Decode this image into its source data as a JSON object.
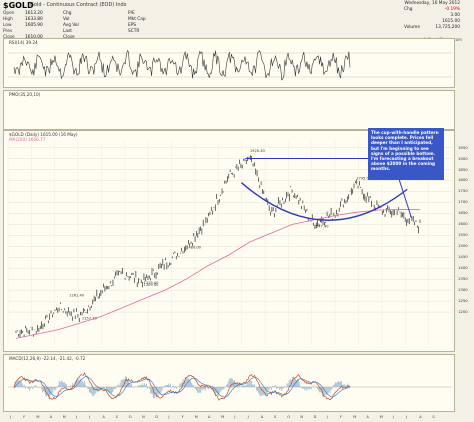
{
  "header": {
    "ticker": "$GOLD",
    "description": "Gold - Continuous Contract (EOD) Indx",
    "stats_left": [
      {
        "label": "Open",
        "value": "1613.20"
      },
      {
        "label": "High",
        "value": "1633.80"
      },
      {
        "label": "Low",
        "value": "1605.90"
      },
      {
        "label": "Prev Close",
        "value": "1610.00"
      }
    ],
    "stats_mid": [
      {
        "label": "Chg",
        "value": ""
      },
      {
        "label": "Vol",
        "value": ""
      },
      {
        "label": "Avg Vol",
        "value": ""
      },
      {
        "label": "Last Close",
        "value": ""
      }
    ],
    "stats_mid2": [
      {
        "label": "P/E",
        "value": ""
      },
      {
        "label": "Mkt Cap",
        "value": ""
      },
      {
        "label": "EPS",
        "value": ""
      },
      {
        "label": "SCTR",
        "value": ""
      }
    ],
    "stats_right": [
      {
        "label": "Chg",
        "value": "-0.19%"
      },
      {
        "label": "",
        "value": "3.00"
      },
      {
        "label": "",
        "value": "1615.00"
      },
      {
        "label": "Volume",
        "value": "13,725,200"
      }
    ],
    "stats_right_top": "Wednesday, 16 May 2012",
    "watermark": "© StockCharts.com"
  },
  "rsi_panel": {
    "label": "RSI(14) 39.24"
  },
  "pmo_panel": {
    "label": "PMO(35,20,10)"
  },
  "main_panel": {
    "label": "$GOLD (Daily) 1615.00 (16 May)",
    "ma_label": "MA(200) 1666.77"
  },
  "macd_panel": {
    "label": "MACD(12,26,9) -22.14, -21.42, -0.72"
  },
  "callout": {
    "text": "The cup-with-handle pattern looks complete. Prices fell deeper than I anticipated, but I'm beginning to see signs of a possible bottom. I'm forecasting a breakout above $2000 in the coming months."
  },
  "chart_data": {
    "type": "line",
    "title": "$GOLD (Daily) 1615.00 (16 May)",
    "y_axis_ticks": [
      "1950",
      "1900",
      "1850",
      "1800",
      "1750",
      "1700",
      "1650",
      "1600",
      "1550",
      "1500",
      "1450",
      "1400",
      "1350",
      "1300",
      "1250",
      "1200"
    ],
    "annotations": [
      {
        "label": "1920.30",
        "x": "Sep 2011",
        "y": 1920
      },
      {
        "label": "1577.40",
        "x": "Dec 2011",
        "y": 1577
      },
      {
        "label": "1795.00",
        "x": "Feb 2012",
        "y": 1795
      },
      {
        "label": "1261.40",
        "x": "Jun 2010",
        "y": 1261
      },
      {
        "label": "1157.10",
        "x": "Jul 2010",
        "y": 1157
      },
      {
        "label": "1309.50",
        "x": "Jan 2011",
        "y": 1309
      },
      {
        "label": "1319.40",
        "x": "Jan 2011",
        "y": 1319
      },
      {
        "label": "1480.00",
        "x": "May 2011",
        "y": 1480
      }
    ],
    "series": [
      {
        "name": "$GOLD",
        "x": [
          "Jan10",
          "Mar10",
          "May10",
          "Jul10",
          "Sep10",
          "Nov10",
          "Jan11",
          "Mar11",
          "May11",
          "Jul11",
          "Aug11",
          "Sep11",
          "Oct11",
          "Nov11",
          "Dec11",
          "Jan12",
          "Feb12",
          "Mar12",
          "Apr12",
          "May12"
        ],
        "values": [
          1110,
          1120,
          1220,
          1180,
          1290,
          1380,
          1340,
          1420,
          1500,
          1620,
          1820,
          1900,
          1650,
          1760,
          1600,
          1650,
          1780,
          1670,
          1650,
          1590
        ]
      },
      {
        "name": "MA(200)",
        "x": [
          "Jan10",
          "Mar10",
          "May10",
          "Jul10",
          "Sep10",
          "Nov10",
          "Jan11",
          "Mar11",
          "May11",
          "Jul11",
          "Aug11",
          "Sep11",
          "Oct11",
          "Nov11",
          "Dec11",
          "Jan12",
          "Feb12",
          "Mar12",
          "Apr12",
          "May12"
        ],
        "values": [
          1080,
          1100,
          1120,
          1150,
          1180,
          1220,
          1260,
          1300,
          1350,
          1410,
          1460,
          1520,
          1560,
          1600,
          1620,
          1640,
          1655,
          1665,
          1668,
          1667
        ]
      }
    ]
  },
  "colors": {
    "price": "#2b2b2b",
    "ma": "#e06aa0",
    "cup": "#2f38c0",
    "rsi": "#333",
    "macd": "#c04a20",
    "macd_signal": "#3070c0",
    "callout": "#3a57c8"
  }
}
